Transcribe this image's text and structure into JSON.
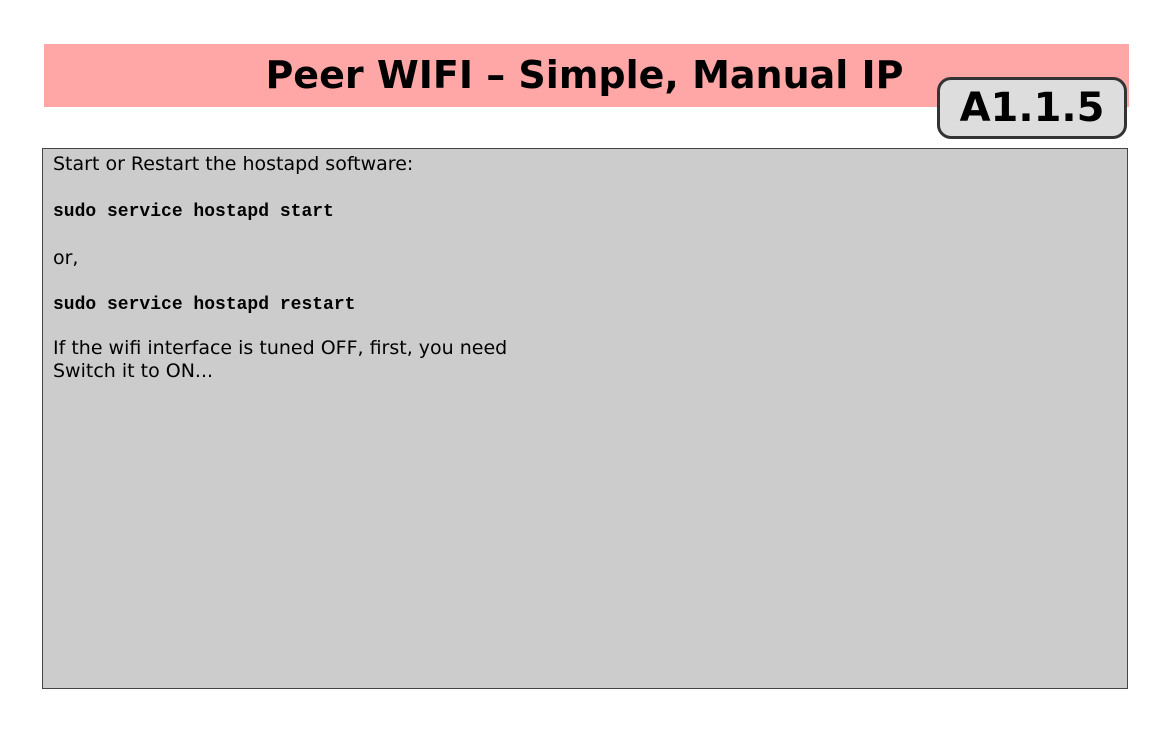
{
  "slide": {
    "title": "Peer WIFI – Simple, Manual IP",
    "badge": "A1.1.5"
  },
  "content": {
    "line1": "Start or Restart the hostapd software:",
    "cmd_start": "sudo service hostapd start",
    "or_text": "or,",
    "cmd_restart": "sudo service hostapd restart",
    "note_line1": "If the wifi interface is tuned OFF, first, you need",
    "note_line2": "Switch it to ON..."
  },
  "colors": {
    "title_bar": "#ffa6a6",
    "badge_background": "#dddddd",
    "badge_border": "#333333",
    "content_background": "#cccccc"
  }
}
